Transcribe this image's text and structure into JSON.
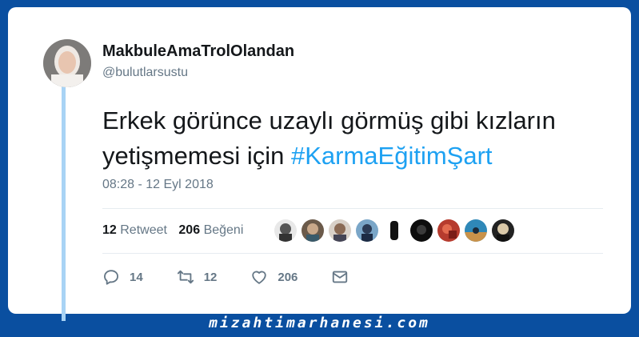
{
  "tweet": {
    "display_name": "MakbuleAmaTrolOlandan",
    "handle": "@bulutlarsustu",
    "text_plain": "Erkek görünce uzaylı görmüş gibi kızların yetişmemesi için ",
    "hashtag": "#KarmaEğitimŞart",
    "timestamp": "08:28 - 12 Eyl 2018"
  },
  "stats": {
    "retweet_count": "12",
    "retweet_label": "Retweet",
    "like_count": "206",
    "like_label": "Beğeni"
  },
  "actions": {
    "reply_count": "14",
    "retweet_count": "12",
    "like_count": "206"
  },
  "watermark": "mizahtimarhanesi.com",
  "colors": {
    "background": "#0a4fa0",
    "hashtag": "#1da1f2",
    "thread_line": "#a8d3f5"
  },
  "icons": [
    "reply-icon",
    "retweet-icon",
    "heart-icon",
    "message-icon"
  ]
}
